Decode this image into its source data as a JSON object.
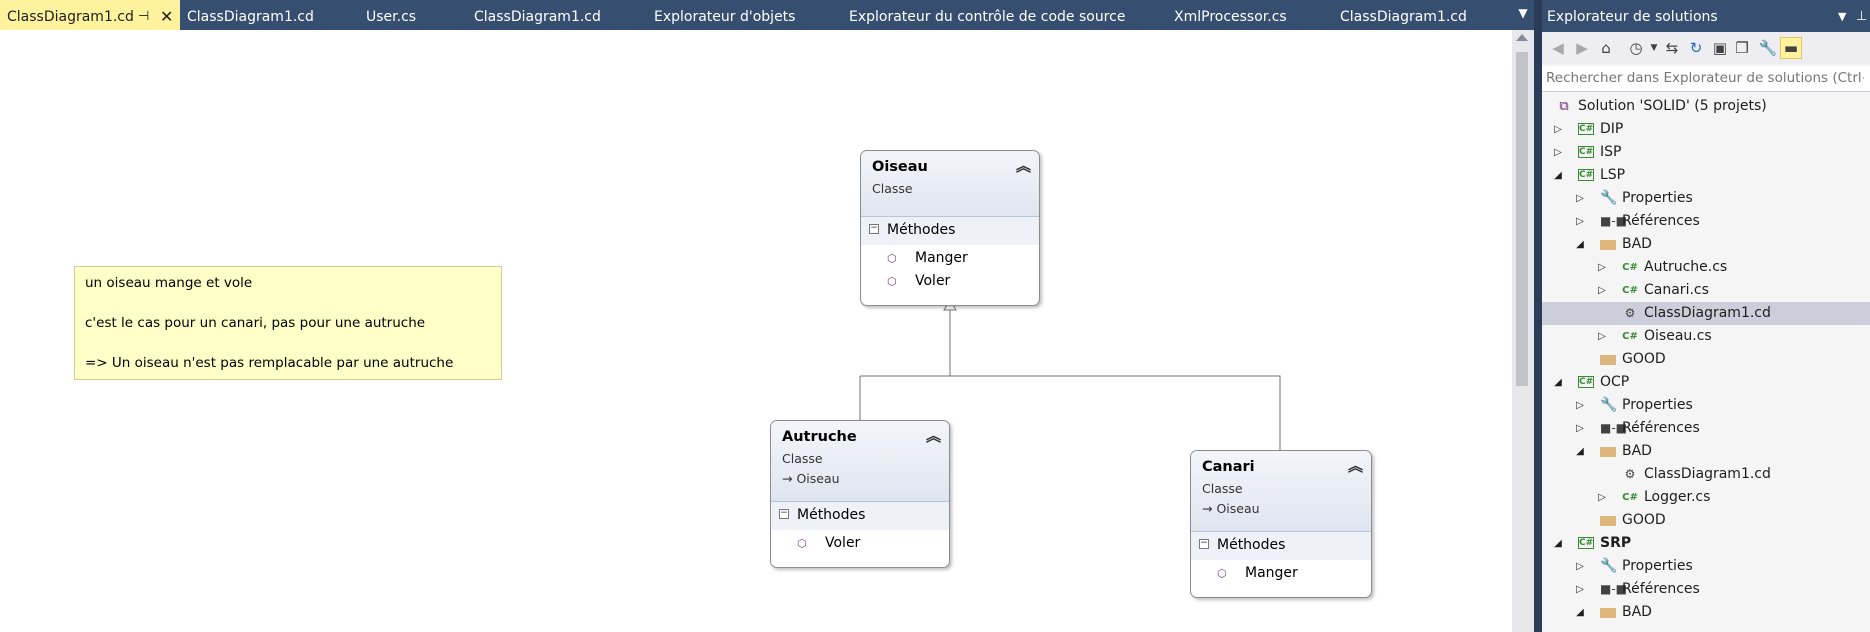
{
  "tabs": [
    {
      "label": "ClassDiagram1.cd",
      "active": true
    },
    {
      "label": "ClassDiagram1.cd"
    },
    {
      "label": "User.cs"
    },
    {
      "label": "ClassDiagram1.cd"
    },
    {
      "label": "Explorateur d'objets"
    },
    {
      "label": "Explorateur du contrôle de code source"
    },
    {
      "label": "XmlProcessor.cs"
    },
    {
      "label": "ClassDiagram1.cd"
    }
  ],
  "comment": {
    "line1": "un oiseau mange et vole",
    "line2": "c'est le cas pour un canari, pas pour une autruche",
    "line3": "=> Un oiseau n'est pas remplacable par une autruche"
  },
  "classes": {
    "oiseau": {
      "name": "Oiseau",
      "kind": "Classe",
      "section": "Méthodes",
      "methods": [
        "Manger",
        "Voler"
      ]
    },
    "autruche": {
      "name": "Autruche",
      "kind": "Classe",
      "base": "Oiseau",
      "section": "Méthodes",
      "methods": [
        "Voler"
      ]
    },
    "canari": {
      "name": "Canari",
      "kind": "Classe",
      "base": "Oiseau",
      "section": "Méthodes",
      "methods": [
        "Manger"
      ]
    }
  },
  "solution_explorer": {
    "title": "Explorateur de solutions",
    "search_placeholder": "Rechercher dans Explorateur de solutions (Ctrl+",
    "items": [
      {
        "label": "Solution 'SOLID' (5 projets)",
        "icon": "solution-icon"
      },
      {
        "label": "DIP",
        "icon": "csharp-project-icon"
      },
      {
        "label": "ISP",
        "icon": "csharp-project-icon"
      },
      {
        "label": "LSP",
        "icon": "csharp-project-icon"
      },
      {
        "label": "Properties",
        "icon": "wrench-icon"
      },
      {
        "label": "Références",
        "icon": "references-icon"
      },
      {
        "label": "BAD",
        "icon": "folder-icon"
      },
      {
        "label": "Autruche.cs",
        "icon": "csharp-file-icon"
      },
      {
        "label": "Canari.cs",
        "icon": "csharp-file-icon"
      },
      {
        "label": "ClassDiagram1.cd",
        "icon": "class-diagram-icon",
        "selected": true
      },
      {
        "label": "Oiseau.cs",
        "icon": "csharp-file-icon"
      },
      {
        "label": "GOOD",
        "icon": "folder-icon"
      },
      {
        "label": "OCP",
        "icon": "csharp-project-icon"
      },
      {
        "label": "Properties",
        "icon": "wrench-icon"
      },
      {
        "label": "Références",
        "icon": "references-icon"
      },
      {
        "label": "BAD",
        "icon": "folder-icon"
      },
      {
        "label": "ClassDiagram1.cd",
        "icon": "class-diagram-icon"
      },
      {
        "label": "Logger.cs",
        "icon": "csharp-file-icon"
      },
      {
        "label": "GOOD",
        "icon": "folder-icon"
      },
      {
        "label": "SRP",
        "icon": "csharp-project-icon",
        "bold": true
      },
      {
        "label": "Properties",
        "icon": "wrench-icon"
      },
      {
        "label": "Références",
        "icon": "references-icon"
      },
      {
        "label": "BAD",
        "icon": "folder-icon"
      }
    ]
  },
  "colors": {
    "accent": "#fff29d",
    "chrome": "#364e6f",
    "selection": "#cccedb"
  }
}
